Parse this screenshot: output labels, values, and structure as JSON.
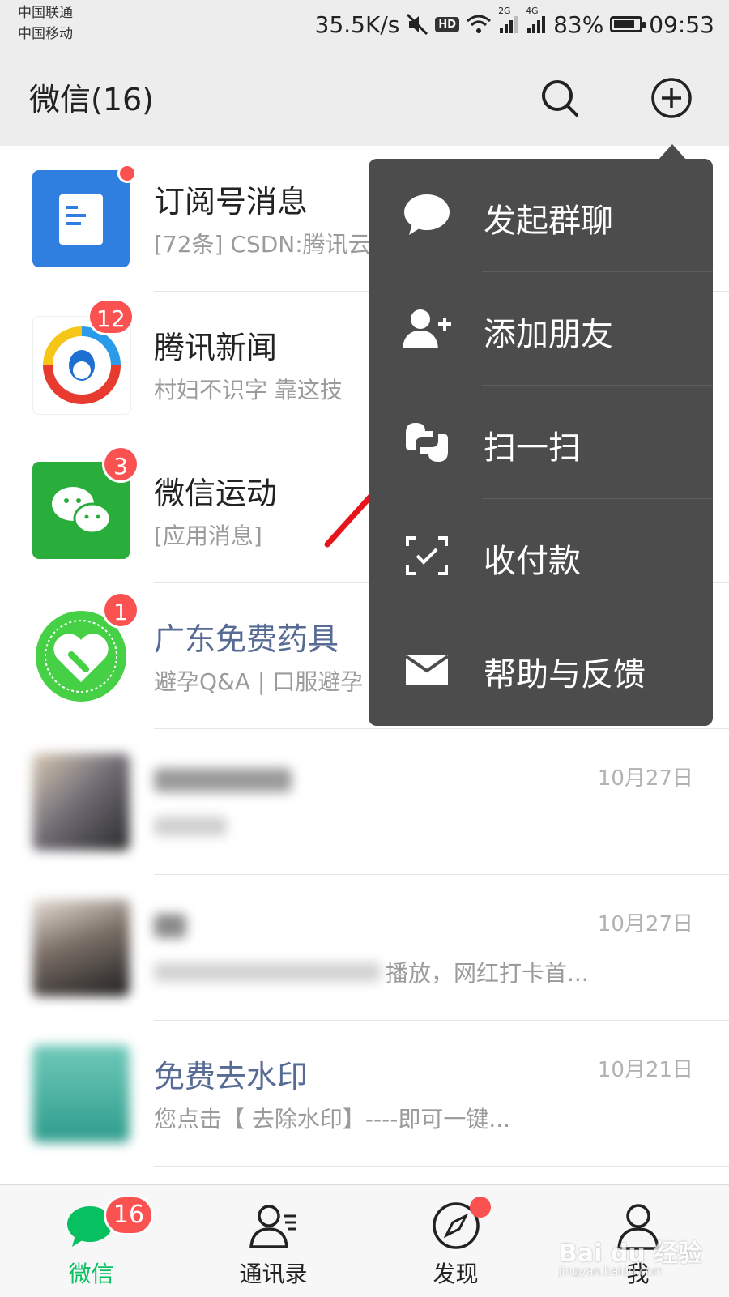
{
  "status_bar": {
    "carrier1": "中国联通",
    "carrier2": "中国移动",
    "speed": "35.5K/s",
    "hd": "HD",
    "net_2g": "2G",
    "net_4g": "4G",
    "battery": "83%",
    "battery_level": 0.83,
    "time": "09:53"
  },
  "header": {
    "title": "微信(16)",
    "search_icon": "search-icon",
    "add_icon": "plus-circle-icon"
  },
  "chats": [
    {
      "name": "订阅号消息",
      "message": "[72条] CSDN:腾讯云",
      "time": "",
      "badge": "",
      "dot": true,
      "name_color": "#222222"
    },
    {
      "name": "腾讯新闻",
      "message": "村妇不识字 靠这技",
      "time": "",
      "badge": "12",
      "dot": false,
      "name_color": "#222222"
    },
    {
      "name": "微信运动",
      "message": "[应用消息]",
      "time": "",
      "badge": "3",
      "dot": false,
      "name_color": "#222222"
    },
    {
      "name": "广东免费药具",
      "message": "避孕Q&A | 口服避孕",
      "time": "",
      "badge": "1",
      "dot": false,
      "name_color": "#576b95"
    },
    {
      "name": "",
      "message": "",
      "time": "10月27日",
      "badge": "",
      "dot": false,
      "name_color": "#222222"
    },
    {
      "name": "",
      "message": "播放，网红打卡首...",
      "time": "10月27日",
      "badge": "",
      "dot": false,
      "name_color": "#222222"
    },
    {
      "name": "免费去水印",
      "message": "您点击【 去除水印】----即可一键...",
      "time": "10月21日",
      "badge": "",
      "dot": false,
      "name_color": "#576b95"
    }
  ],
  "popup_menu": {
    "items": [
      {
        "label": "发起群聊",
        "icon": "chat-bubble-icon"
      },
      {
        "label": "添加朋友",
        "icon": "add-friend-icon"
      },
      {
        "label": "扫一扫",
        "icon": "scan-icon"
      },
      {
        "label": "收付款",
        "icon": "payment-icon"
      },
      {
        "label": "帮助与反馈",
        "icon": "mail-icon"
      }
    ]
  },
  "tab_bar": {
    "tabs": [
      {
        "label": "微信",
        "icon": "chat-icon",
        "badge": "16",
        "active": true
      },
      {
        "label": "通讯录",
        "icon": "contacts-icon",
        "badge": "",
        "active": false
      },
      {
        "label": "发现",
        "icon": "compass-icon",
        "badge": "",
        "active": false,
        "dot": true
      },
      {
        "label": "我",
        "icon": "profile-icon",
        "badge": "",
        "active": false
      }
    ]
  },
  "watermark": {
    "text": "Bai du 经验",
    "sub": "jingyan.baidu.com"
  },
  "colors": {
    "accent": "#07c160",
    "badge": "#fa5151",
    "popup_bg": "#4c4c4c",
    "link_name": "#576b95",
    "annotation_arrow": "#e8141b"
  }
}
